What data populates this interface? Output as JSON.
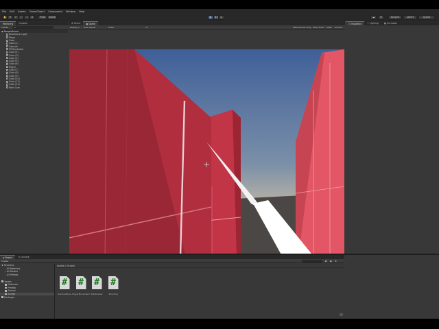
{
  "menu": [
    "File",
    "Edit",
    "Assets",
    "GameObject",
    "Component",
    "Window",
    "Help"
  ],
  "toolbar": {
    "layers": "Layers",
    "layout": "Layout",
    "account": "Account",
    "play_icon": "play-icon",
    "pause_icon": "pause-icon",
    "step_icon": "step-icon"
  },
  "hierarchy": {
    "tabs": [
      "Hierarchy",
      "Console"
    ],
    "create": "Create",
    "search_placeholder": "All",
    "scene_name": "SampleScene",
    "items": [
      "Directional Light",
      "Plane",
      "Cube",
      "Cube (1)",
      "Capsule",
      "FPSController",
      "Cube (2)",
      "Cube (3)",
      "Cube (4)",
      "Cube (5)",
      "Cube (6)",
      "Player",
      "Cube (7)",
      "Cube (8)",
      "Cube (9)",
      "Cube (10)",
      "Cube (11)",
      "Cube (12)",
      "Main Cam"
    ]
  },
  "scene": {
    "tabs": [
      "Scene",
      "Game"
    ],
    "display": "Display 1",
    "aspect": "Free Aspect",
    "scale_label": "Scale",
    "scale_value": "1x",
    "right_toggles": [
      "Maximize On Play",
      "Mute Audio",
      "Stats",
      "Gizmos"
    ]
  },
  "inspector": {
    "tabs": [
      "Inspector",
      "Lighting",
      "Occlusion"
    ]
  },
  "project": {
    "tabs": [
      "Project",
      "Console"
    ],
    "create": "Create",
    "favorites_label": "Favorites",
    "favorites": [
      "All Materials",
      "All Models",
      "All Prefabs"
    ],
    "assets_label": "Assets",
    "assets_folders": [
      "Materials",
      "Prefabs",
      "Scenes",
      "Scripts"
    ],
    "packages_label": "Packages",
    "breadcrumb": "Assets > Scripts",
    "files": [
      "CameraMove",
      "PlayerMovement",
      "RotateView",
      "Shooting"
    ]
  },
  "colors": {
    "editor_bg": "#383838",
    "dark_bar": "#282828",
    "accent": "#3a79bb",
    "wall_red": "#b13244",
    "sky_top": "#3f5f99"
  }
}
